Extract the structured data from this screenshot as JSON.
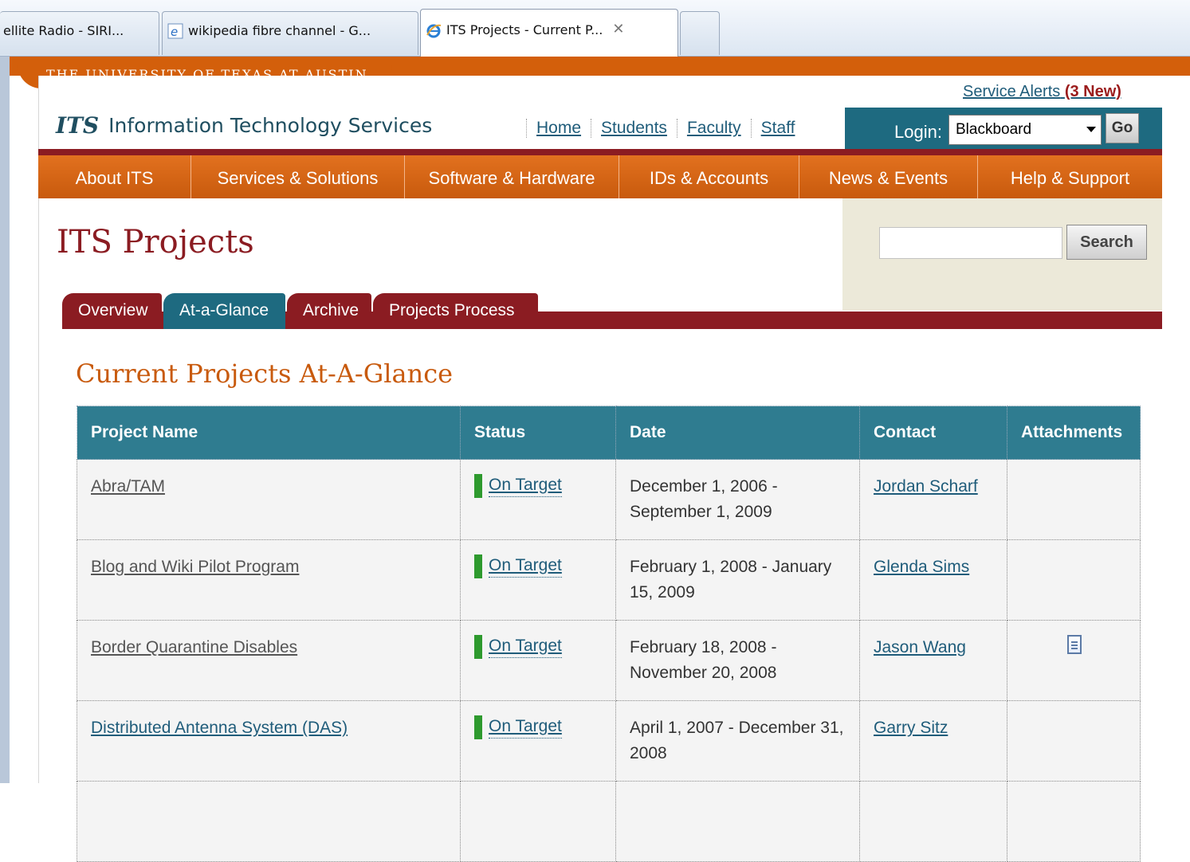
{
  "browser": {
    "tabs": [
      {
        "label": "ellite Radio - SIRI..."
      },
      {
        "label": "wikipedia fibre channel - G..."
      },
      {
        "label": "ITS Projects - Current P..."
      }
    ],
    "close_glyph": "✕"
  },
  "header": {
    "university": "THE UNIVERSITY OF TEXAS AT AUSTIN",
    "service_alerts": "Service Alerts",
    "service_alerts_count": "(3 New)",
    "logo_mark": "ITS",
    "logo_text": "Information Technology Services",
    "top_links": [
      "Home",
      "Students",
      "Faculty",
      "Staff"
    ],
    "login_label": "Login:",
    "login_selected": "Blackboard",
    "go_label": "Go"
  },
  "nav": {
    "items": [
      "About ITS",
      "Services & Solutions",
      "Software & Hardware",
      "IDs & Accounts",
      "News & Events",
      "Help & Support"
    ]
  },
  "search": {
    "button_label": "Search",
    "placeholder": ""
  },
  "page": {
    "title": "ITS Projects",
    "tabs": [
      "Overview",
      "At-a-Glance",
      "Archive",
      "Projects Process"
    ],
    "active_tab": "At-a-Glance",
    "section_title": "Current Projects At-A-Glance"
  },
  "table": {
    "headers": [
      "Project Name",
      "Status",
      "Date",
      "Contact",
      "Attachments"
    ],
    "rows": [
      {
        "name": "Abra/TAM",
        "status": "On Target",
        "date": "December 1, 2006 - September 1, 2009",
        "contact": "Jordan Scharf",
        "attachment": ""
      },
      {
        "name": "Blog and Wiki Pilot Program",
        "status": "On Target",
        "date": "February 1, 2008 - January 15, 2009",
        "contact": "Glenda Sims",
        "attachment": ""
      },
      {
        "name": "Border Quarantine Disables",
        "status": "On Target",
        "date": "February 18, 2008 - November 20, 2008",
        "contact": "Jason Wang",
        "attachment": "document-icon"
      },
      {
        "name": "Distributed Antenna System (DAS)",
        "status": "On Target",
        "date": "April 1, 2007 - December 31, 2008",
        "contact": "Garry Sitz",
        "attachment": ""
      }
    ]
  },
  "colors": {
    "burnt_orange": "#d35f0b",
    "maroon": "#8b1c22",
    "teal": "#2f7c90",
    "status_green": "#2e9a2e"
  }
}
